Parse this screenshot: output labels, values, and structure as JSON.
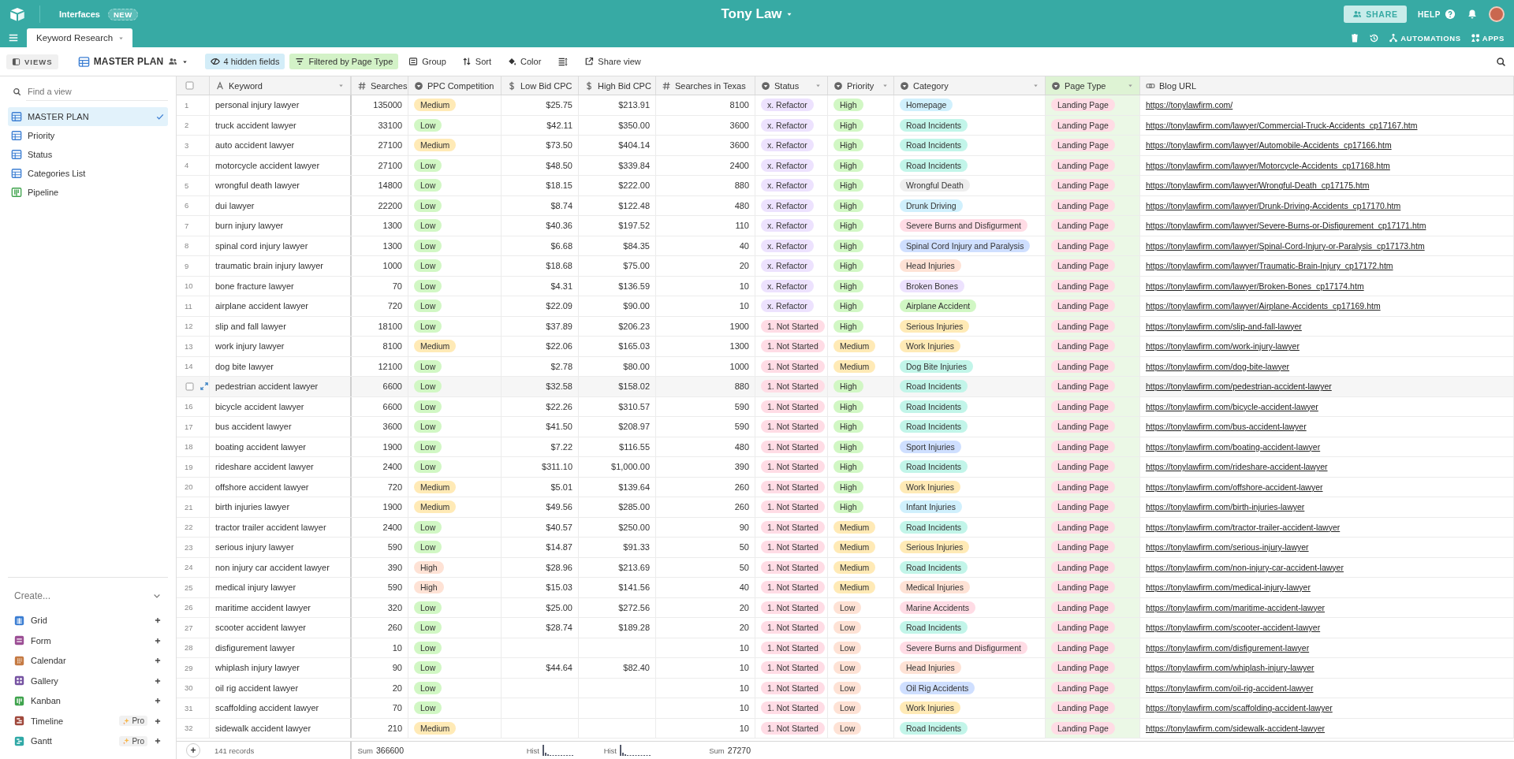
{
  "topbar": {
    "interfaces_link": "Interfaces",
    "new_badge": "NEW",
    "base_title": "Tony Law",
    "share_button": "SHARE",
    "help_link": "HELP"
  },
  "tabs_bar": {
    "tabs": [
      {
        "label": "Keyword Research",
        "selected": true
      }
    ],
    "actions": [
      {
        "label": "AUTOMATIONS",
        "kind": "automations"
      },
      {
        "label": "APPS",
        "kind": "apps"
      }
    ]
  },
  "toolbar": {
    "views_button": "VIEWS",
    "current_view": "MASTER PLAN",
    "hidden_fields": "4 hidden fields",
    "filter": "Filtered by Page Type",
    "group": "Group",
    "sort": "Sort",
    "color_button": "Color",
    "share_view": "Share view"
  },
  "sidebar": {
    "search": {
      "placeholder": "Find a view"
    },
    "views": [
      {
        "label": "MASTER PLAN",
        "kind": "grid",
        "selected": true
      },
      {
        "label": "Priority",
        "kind": "grid",
        "selected": false
      },
      {
        "label": "Status",
        "kind": "grid",
        "selected": false
      },
      {
        "label": "Categories List",
        "kind": "grid",
        "selected": false
      },
      {
        "label": "Pipeline",
        "kind": "kanban",
        "selected": false
      }
    ],
    "create": {
      "title": "Create...",
      "items": [
        {
          "label": "Grid",
          "kind": "grid"
        },
        {
          "label": "Form",
          "kind": "form"
        },
        {
          "label": "Calendar",
          "kind": "calendar"
        },
        {
          "label": "Gallery",
          "kind": "gallery"
        },
        {
          "label": "Kanban",
          "kind": "kanban"
        },
        {
          "label": "Timeline",
          "kind": "timeline",
          "badge": "Pro"
        },
        {
          "label": "Gantt",
          "kind": "gantt",
          "badge": "Pro"
        }
      ]
    }
  },
  "table": {
    "select_all": {
      "checked": false
    },
    "columns": [
      {
        "label": "Keyword",
        "kind": "text",
        "filtered": false
      },
      {
        "label": "Searches",
        "kind": "number",
        "filtered": false,
        "summary": {
          "kind": "sum",
          "label": "Sum",
          "value": "366600"
        }
      },
      {
        "label": "PPC Competition",
        "kind": "select",
        "filtered": false
      },
      {
        "label": "Low Bid CPC",
        "kind": "currency",
        "filtered": false,
        "summary": {
          "kind": "histogram",
          "label": "Hist"
        }
      },
      {
        "label": "High Bid CPC",
        "kind": "currency",
        "filtered": false,
        "summary": {
          "kind": "histogram",
          "label": "Hist"
        }
      },
      {
        "label": "Searches in Texas",
        "kind": "number",
        "filtered": false,
        "summary": {
          "kind": "sum",
          "label": "Sum",
          "value": "27270"
        }
      },
      {
        "label": "Status",
        "kind": "select",
        "filtered": false
      },
      {
        "label": "Priority",
        "kind": "select",
        "filtered": false
      },
      {
        "label": "Category",
        "kind": "select",
        "filtered": false
      },
      {
        "label": "Page Type",
        "kind": "select",
        "filtered": true
      },
      {
        "label": "Blog URL",
        "kind": "url",
        "filtered": false
      }
    ],
    "rows": [
      {
        "number": "1",
        "hovered": false,
        "cells": [
          "personal injury lawyer",
          "135000",
          {
            "text": "Medium",
            "color": "#ffeab6"
          },
          "$25.75",
          "$213.91",
          "8100",
          {
            "text": "x. Refactor",
            "color": "#ede2fe"
          },
          {
            "text": "High",
            "color": "#d1f7c4"
          },
          {
            "text": "Homepage",
            "color": "#d0f0fd"
          },
          {
            "text": "Landing Page",
            "color": "#ffdce5"
          },
          "https://tonylawfirm.com/"
        ]
      },
      {
        "number": "2",
        "hovered": false,
        "cells": [
          "truck accident lawyer",
          "33100",
          {
            "text": "Low",
            "color": "#d1f7c4"
          },
          "$42.11",
          "$350.00",
          "3600",
          {
            "text": "x. Refactor",
            "color": "#ede2fe"
          },
          {
            "text": "High",
            "color": "#d1f7c4"
          },
          {
            "text": "Road Incidents",
            "color": "#c2f5e9"
          },
          {
            "text": "Landing Page",
            "color": "#ffdce5"
          },
          "https://tonylawfirm.com/lawyer/Commercial-Truck-Accidents_cp17167.htm"
        ]
      },
      {
        "number": "3",
        "hovered": false,
        "cells": [
          "auto accident lawyer",
          "27100",
          {
            "text": "Medium",
            "color": "#ffeab6"
          },
          "$73.50",
          "$404.14",
          "3600",
          {
            "text": "x. Refactor",
            "color": "#ede2fe"
          },
          {
            "text": "High",
            "color": "#d1f7c4"
          },
          {
            "text": "Road Incidents",
            "color": "#c2f5e9"
          },
          {
            "text": "Landing Page",
            "color": "#ffdce5"
          },
          "https://tonylawfirm.com/lawyer/Automobile-Accidents_cp17166.htm"
        ]
      },
      {
        "number": "4",
        "hovered": false,
        "cells": [
          "motorcycle accident lawyer",
          "27100",
          {
            "text": "Low",
            "color": "#d1f7c4"
          },
          "$48.50",
          "$339.84",
          "2400",
          {
            "text": "x. Refactor",
            "color": "#ede2fe"
          },
          {
            "text": "High",
            "color": "#d1f7c4"
          },
          {
            "text": "Road Incidents",
            "color": "#c2f5e9"
          },
          {
            "text": "Landing Page",
            "color": "#ffdce5"
          },
          "https://tonylawfirm.com/lawyer/Motorcycle-Accidents_cp17168.htm"
        ]
      },
      {
        "number": "5",
        "hovered": false,
        "cells": [
          "wrongful death lawyer",
          "14800",
          {
            "text": "Low",
            "color": "#d1f7c4"
          },
          "$18.15",
          "$222.00",
          "880",
          {
            "text": "x. Refactor",
            "color": "#ede2fe"
          },
          {
            "text": "High",
            "color": "#d1f7c4"
          },
          {
            "text": "Wrongful Death",
            "color": "#eeeeee"
          },
          {
            "text": "Landing Page",
            "color": "#ffdce5"
          },
          "https://tonylawfirm.com/lawyer/Wrongful-Death_cp17175.htm"
        ]
      },
      {
        "number": "6",
        "hovered": false,
        "cells": [
          "dui lawyer",
          "22200",
          {
            "text": "Low",
            "color": "#d1f7c4"
          },
          "$8.74",
          "$122.48",
          "480",
          {
            "text": "x. Refactor",
            "color": "#ede2fe"
          },
          {
            "text": "High",
            "color": "#d1f7c4"
          },
          {
            "text": "Drunk Driving",
            "color": "#d0f0fd"
          },
          {
            "text": "Landing Page",
            "color": "#ffdce5"
          },
          "https://tonylawfirm.com/lawyer/Drunk-Driving-Accidents_cp17170.htm"
        ]
      },
      {
        "number": "7",
        "hovered": false,
        "cells": [
          "burn injury lawyer",
          "1300",
          {
            "text": "Low",
            "color": "#d1f7c4"
          },
          "$40.36",
          "$197.52",
          "110",
          {
            "text": "x. Refactor",
            "color": "#ede2fe"
          },
          {
            "text": "High",
            "color": "#d1f7c4"
          },
          {
            "text": "Severe Burns and Disfigurment",
            "color": "#ffdce5"
          },
          {
            "text": "Landing Page",
            "color": "#ffdce5"
          },
          "https://tonylawfirm.com/lawyer/Severe-Burns-or-Disfigurement_cp17171.htm"
        ]
      },
      {
        "number": "8",
        "hovered": false,
        "cells": [
          "spinal cord injury lawyer",
          "1300",
          {
            "text": "Low",
            "color": "#d1f7c4"
          },
          "$6.68",
          "$84.35",
          "40",
          {
            "text": "x. Refactor",
            "color": "#ede2fe"
          },
          {
            "text": "High",
            "color": "#d1f7c4"
          },
          {
            "text": "Spinal Cord Injury and Paralysis",
            "color": "#cfdfff"
          },
          {
            "text": "Landing Page",
            "color": "#ffdce5"
          },
          "https://tonylawfirm.com/lawyer/Spinal-Cord-Injury-or-Paralysis_cp17173.htm"
        ]
      },
      {
        "number": "9",
        "hovered": false,
        "cells": [
          "traumatic brain injury lawyer",
          "1000",
          {
            "text": "Low",
            "color": "#d1f7c4"
          },
          "$18.68",
          "$75.00",
          "20",
          {
            "text": "x. Refactor",
            "color": "#ede2fe"
          },
          {
            "text": "High",
            "color": "#d1f7c4"
          },
          {
            "text": "Head Injuries",
            "color": "#fee2d5"
          },
          {
            "text": "Landing Page",
            "color": "#ffdce5"
          },
          "https://tonylawfirm.com/lawyer/Traumatic-Brain-Injury_cp17172.htm"
        ]
      },
      {
        "number": "10",
        "hovered": false,
        "cells": [
          "bone fracture lawyer",
          "70",
          {
            "text": "Low",
            "color": "#d1f7c4"
          },
          "$4.31",
          "$136.59",
          "10",
          {
            "text": "x. Refactor",
            "color": "#ede2fe"
          },
          {
            "text": "High",
            "color": "#d1f7c4"
          },
          {
            "text": "Broken Bones",
            "color": "#ede2fe"
          },
          {
            "text": "Landing Page",
            "color": "#ffdce5"
          },
          "https://tonylawfirm.com/lawyer/Broken-Bones_cp17174.htm"
        ]
      },
      {
        "number": "11",
        "hovered": false,
        "cells": [
          "airplane accident lawyer",
          "720",
          {
            "text": "Low",
            "color": "#d1f7c4"
          },
          "$22.09",
          "$90.00",
          "10",
          {
            "text": "x. Refactor",
            "color": "#ede2fe"
          },
          {
            "text": "High",
            "color": "#d1f7c4"
          },
          {
            "text": "Airplane Accident",
            "color": "#d1f7c4"
          },
          {
            "text": "Landing Page",
            "color": "#ffdce5"
          },
          "https://tonylawfirm.com/lawyer/Airplane-Accidents_cp17169.htm"
        ]
      },
      {
        "number": "12",
        "hovered": false,
        "cells": [
          "slip and fall lawyer",
          "18100",
          {
            "text": "Low",
            "color": "#d1f7c4"
          },
          "$37.89",
          "$206.23",
          "1900",
          {
            "text": "1. Not Started",
            "color": "#ffdce5"
          },
          {
            "text": "High",
            "color": "#d1f7c4"
          },
          {
            "text": "Serious Injuries",
            "color": "#ffeab6"
          },
          {
            "text": "Landing Page",
            "color": "#ffdce5"
          },
          "https://tonylawfirm.com/slip-and-fall-lawyer"
        ]
      },
      {
        "number": "13",
        "hovered": false,
        "cells": [
          "work injury lawyer",
          "8100",
          {
            "text": "Medium",
            "color": "#ffeab6"
          },
          "$22.06",
          "$165.03",
          "1300",
          {
            "text": "1. Not Started",
            "color": "#ffdce5"
          },
          {
            "text": "Medium",
            "color": "#ffeab6"
          },
          {
            "text": "Work Injuries",
            "color": "#ffeab6"
          },
          {
            "text": "Landing Page",
            "color": "#ffdce5"
          },
          "https://tonylawfirm.com/work-injury-lawyer"
        ]
      },
      {
        "number": "14",
        "hovered": false,
        "cells": [
          "dog bite lawyer",
          "12100",
          {
            "text": "Low",
            "color": "#d1f7c4"
          },
          "$2.78",
          "$80.00",
          "1000",
          {
            "text": "1. Not Started",
            "color": "#ffdce5"
          },
          {
            "text": "Medium",
            "color": "#ffeab6"
          },
          {
            "text": "Dog Bite Injuries",
            "color": "#c2f5e9"
          },
          {
            "text": "Landing Page",
            "color": "#ffdce5"
          },
          "https://tonylawfirm.com/dog-bite-lawyer"
        ]
      },
      {
        "hovered": true,
        "cells": [
          "pedestrian accident lawyer",
          "6600",
          {
            "text": "Low",
            "color": "#d1f7c4"
          },
          "$32.58",
          "$158.02",
          "880",
          {
            "text": "1. Not Started",
            "color": "#ffdce5"
          },
          {
            "text": "High",
            "color": "#d1f7c4"
          },
          {
            "text": "Road Incidents",
            "color": "#c2f5e9"
          },
          {
            "text": "Landing Page",
            "color": "#ffdce5"
          },
          "https://tonylawfirm.com/pedestrian-accident-lawyer"
        ]
      },
      {
        "number": "16",
        "hovered": false,
        "cells": [
          "bicycle accident lawyer",
          "6600",
          {
            "text": "Low",
            "color": "#d1f7c4"
          },
          "$22.26",
          "$310.57",
          "590",
          {
            "text": "1. Not Started",
            "color": "#ffdce5"
          },
          {
            "text": "High",
            "color": "#d1f7c4"
          },
          {
            "text": "Road Incidents",
            "color": "#c2f5e9"
          },
          {
            "text": "Landing Page",
            "color": "#ffdce5"
          },
          "https://tonylawfirm.com/bicycle-accident-lawyer"
        ]
      },
      {
        "number": "17",
        "hovered": false,
        "cells": [
          "bus accident lawyer",
          "3600",
          {
            "text": "Low",
            "color": "#d1f7c4"
          },
          "$41.50",
          "$208.97",
          "590",
          {
            "text": "1. Not Started",
            "color": "#ffdce5"
          },
          {
            "text": "High",
            "color": "#d1f7c4"
          },
          {
            "text": "Road Incidents",
            "color": "#c2f5e9"
          },
          {
            "text": "Landing Page",
            "color": "#ffdce5"
          },
          "https://tonylawfirm.com/bus-accident-lawyer"
        ]
      },
      {
        "number": "18",
        "hovered": false,
        "cells": [
          "boating accident lawyer",
          "1900",
          {
            "text": "Low",
            "color": "#d1f7c4"
          },
          "$7.22",
          "$116.55",
          "480",
          {
            "text": "1. Not Started",
            "color": "#ffdce5"
          },
          {
            "text": "High",
            "color": "#d1f7c4"
          },
          {
            "text": "Sport Injuries",
            "color": "#cfdfff"
          },
          {
            "text": "Landing Page",
            "color": "#ffdce5"
          },
          "https://tonylawfirm.com/boating-accident-lawyer"
        ]
      },
      {
        "number": "19",
        "hovered": false,
        "cells": [
          "rideshare accident lawyer",
          "2400",
          {
            "text": "Low",
            "color": "#d1f7c4"
          },
          "$311.10",
          "$1,000.00",
          "390",
          {
            "text": "1. Not Started",
            "color": "#ffdce5"
          },
          {
            "text": "High",
            "color": "#d1f7c4"
          },
          {
            "text": "Road Incidents",
            "color": "#c2f5e9"
          },
          {
            "text": "Landing Page",
            "color": "#ffdce5"
          },
          "https://tonylawfirm.com/rideshare-accident-lawyer"
        ]
      },
      {
        "number": "20",
        "hovered": false,
        "cells": [
          "offshore accident lawyer",
          "720",
          {
            "text": "Medium",
            "color": "#ffeab6"
          },
          "$5.01",
          "$139.64",
          "260",
          {
            "text": "1. Not Started",
            "color": "#ffdce5"
          },
          {
            "text": "High",
            "color": "#d1f7c4"
          },
          {
            "text": "Work Injuries",
            "color": "#ffeab6"
          },
          {
            "text": "Landing Page",
            "color": "#ffdce5"
          },
          "https://tonylawfirm.com/offshore-accident-lawyer"
        ]
      },
      {
        "number": "21",
        "hovered": false,
        "cells": [
          "birth injuries lawyer",
          "1900",
          {
            "text": "Medium",
            "color": "#ffeab6"
          },
          "$49.56",
          "$285.00",
          "260",
          {
            "text": "1. Not Started",
            "color": "#ffdce5"
          },
          {
            "text": "High",
            "color": "#d1f7c4"
          },
          {
            "text": "Infant Injuries",
            "color": "#d0f0fd"
          },
          {
            "text": "Landing Page",
            "color": "#ffdce5"
          },
          "https://tonylawfirm.com/birth-injuries-lawyer"
        ]
      },
      {
        "number": "22",
        "hovered": false,
        "cells": [
          "tractor trailer accident lawyer",
          "2400",
          {
            "text": "Low",
            "color": "#d1f7c4"
          },
          "$40.57",
          "$250.00",
          "90",
          {
            "text": "1. Not Started",
            "color": "#ffdce5"
          },
          {
            "text": "Medium",
            "color": "#ffeab6"
          },
          {
            "text": "Road Incidents",
            "color": "#c2f5e9"
          },
          {
            "text": "Landing Page",
            "color": "#ffdce5"
          },
          "https://tonylawfirm.com/tractor-trailer-accident-lawyer"
        ]
      },
      {
        "number": "23",
        "hovered": false,
        "cells": [
          "serious injury lawyer",
          "590",
          {
            "text": "Low",
            "color": "#d1f7c4"
          },
          "$14.87",
          "$91.33",
          "50",
          {
            "text": "1. Not Started",
            "color": "#ffdce5"
          },
          {
            "text": "Medium",
            "color": "#ffeab6"
          },
          {
            "text": "Serious Injuries",
            "color": "#ffeab6"
          },
          {
            "text": "Landing Page",
            "color": "#ffdce5"
          },
          "https://tonylawfirm.com/serious-injury-lawyer"
        ]
      },
      {
        "number": "24",
        "hovered": false,
        "cells": [
          "non injury car accident lawyer",
          "390",
          {
            "text": "High",
            "color": "#fee2d5"
          },
          "$28.96",
          "$213.69",
          "50",
          {
            "text": "1. Not Started",
            "color": "#ffdce5"
          },
          {
            "text": "Medium",
            "color": "#ffeab6"
          },
          {
            "text": "Road Incidents",
            "color": "#c2f5e9"
          },
          {
            "text": "Landing Page",
            "color": "#ffdce5"
          },
          "https://tonylawfirm.com/non-injury-car-accident-lawyer"
        ]
      },
      {
        "number": "25",
        "hovered": false,
        "cells": [
          "medical injury lawyer",
          "590",
          {
            "text": "High",
            "color": "#fee2d5"
          },
          "$15.03",
          "$141.56",
          "40",
          {
            "text": "1. Not Started",
            "color": "#ffdce5"
          },
          {
            "text": "Medium",
            "color": "#ffeab6"
          },
          {
            "text": "Medical Injuries",
            "color": "#fee2d5"
          },
          {
            "text": "Landing Page",
            "color": "#ffdce5"
          },
          "https://tonylawfirm.com/medical-injury-lawyer"
        ]
      },
      {
        "number": "26",
        "hovered": false,
        "cells": [
          "maritime accident lawyer",
          "320",
          {
            "text": "Low",
            "color": "#d1f7c4"
          },
          "$25.00",
          "$272.56",
          "20",
          {
            "text": "1. Not Started",
            "color": "#ffdce5"
          },
          {
            "text": "Low",
            "color": "#fee2d5"
          },
          {
            "text": "Marine Accidents",
            "color": "#ffdce5"
          },
          {
            "text": "Landing Page",
            "color": "#ffdce5"
          },
          "https://tonylawfirm.com/maritime-accident-lawyer"
        ]
      },
      {
        "number": "27",
        "hovered": false,
        "cells": [
          "scooter accident lawyer",
          "260",
          {
            "text": "Low",
            "color": "#d1f7c4"
          },
          "$28.74",
          "$189.28",
          "20",
          {
            "text": "1. Not Started",
            "color": "#ffdce5"
          },
          {
            "text": "Low",
            "color": "#fee2d5"
          },
          {
            "text": "Road Incidents",
            "color": "#c2f5e9"
          },
          {
            "text": "Landing Page",
            "color": "#ffdce5"
          },
          "https://tonylawfirm.com/scooter-accident-lawyer"
        ]
      },
      {
        "number": "28",
        "hovered": false,
        "cells": [
          "disfigurement lawyer",
          "10",
          {
            "text": "Low",
            "color": "#d1f7c4"
          },
          null,
          null,
          "10",
          {
            "text": "1. Not Started",
            "color": "#ffdce5"
          },
          {
            "text": "Low",
            "color": "#fee2d5"
          },
          {
            "text": "Severe Burns and Disfigurment",
            "color": "#ffdce5"
          },
          {
            "text": "Landing Page",
            "color": "#ffdce5"
          },
          "https://tonylawfirm.com/disfigurement-lawyer"
        ]
      },
      {
        "number": "29",
        "hovered": false,
        "cells": [
          "whiplash injury lawyer",
          "90",
          {
            "text": "Low",
            "color": "#d1f7c4"
          },
          "$44.64",
          "$82.40",
          "10",
          {
            "text": "1. Not Started",
            "color": "#ffdce5"
          },
          {
            "text": "Low",
            "color": "#fee2d5"
          },
          {
            "text": "Head Injuries",
            "color": "#fee2d5"
          },
          {
            "text": "Landing Page",
            "color": "#ffdce5"
          },
          "https://tonylawfirm.com/whiplash-injury-lawyer"
        ]
      },
      {
        "number": "30",
        "hovered": false,
        "cells": [
          "oil rig accident lawyer",
          "20",
          {
            "text": "Low",
            "color": "#d1f7c4"
          },
          null,
          null,
          "10",
          {
            "text": "1. Not Started",
            "color": "#ffdce5"
          },
          {
            "text": "Low",
            "color": "#fee2d5"
          },
          {
            "text": "Oil Rig Accidents",
            "color": "#cfdfff"
          },
          {
            "text": "Landing Page",
            "color": "#ffdce5"
          },
          "https://tonylawfirm.com/oil-rig-accident-lawyer"
        ]
      },
      {
        "number": "31",
        "hovered": false,
        "cells": [
          "scaffolding accident lawyer",
          "70",
          {
            "text": "Low",
            "color": "#d1f7c4"
          },
          null,
          null,
          "10",
          {
            "text": "1. Not Started",
            "color": "#ffdce5"
          },
          {
            "text": "Low",
            "color": "#fee2d5"
          },
          {
            "text": "Work Injuries",
            "color": "#ffeab6"
          },
          {
            "text": "Landing Page",
            "color": "#ffdce5"
          },
          "https://tonylawfirm.com/scaffolding-accident-lawyer"
        ]
      },
      {
        "number": "32",
        "hovered": false,
        "cells": [
          "sidewalk accident lawyer",
          "210",
          {
            "text": "Medium",
            "color": "#ffeab6"
          },
          null,
          null,
          "10",
          {
            "text": "1. Not Started",
            "color": "#ffdce5"
          },
          {
            "text": "Low",
            "color": "#fee2d5"
          },
          {
            "text": "Road Incidents",
            "color": "#c2f5e9"
          },
          {
            "text": "Landing Page",
            "color": "#ffdce5"
          },
          "https://tonylawfirm.com/sidewalk-accident-lawyer"
        ]
      }
    ],
    "footer": {
      "add_button": "+",
      "record_count": "141 records"
    }
  }
}
